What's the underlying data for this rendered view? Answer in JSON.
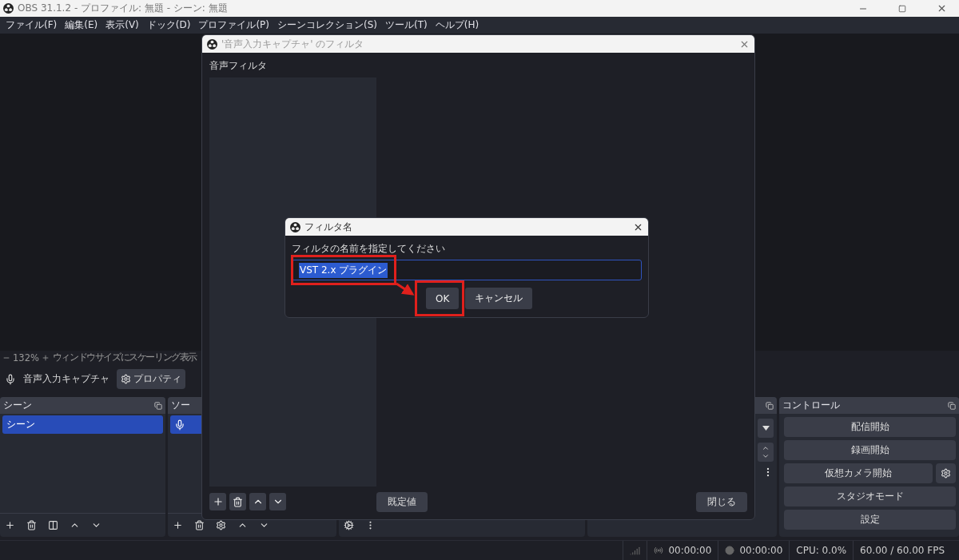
{
  "window": {
    "title": "OBS 31.1.2 - プロファイル: 無題 - シーン: 無題"
  },
  "menu": [
    {
      "label": "ファイル(F)"
    },
    {
      "label": "編集(E)"
    },
    {
      "label": "表示(V)"
    },
    {
      "label": "ドック(D)"
    },
    {
      "label": "プロファイル(P)"
    },
    {
      "label": "シーンコレクション(S)"
    },
    {
      "label": "ツール(T)"
    },
    {
      "label": "ヘルプ(H)"
    }
  ],
  "preview_bar": {
    "zoom": "132%",
    "scale_mode": "ウィンドウサイズにスケーリング表示"
  },
  "source_toolbar": {
    "source": "音声入力キャプチャ",
    "properties": "プロパティ"
  },
  "scenes": {
    "title": "シーン",
    "items": [
      {
        "label": "シーン",
        "selected": true
      }
    ]
  },
  "sources": {
    "title": "ソー",
    "items": [
      {
        "kind": "audio_input",
        "selected": true
      }
    ]
  },
  "controls": {
    "title": "コントロール",
    "buttons": [
      {
        "label": "配信開始",
        "kind": "plain"
      },
      {
        "label": "録画開始",
        "kind": "plain"
      },
      {
        "label": "仮想カメラ開始",
        "kind": "with_settings"
      },
      {
        "label": "スタジオモード",
        "kind": "plain"
      },
      {
        "label": "設定",
        "kind": "plain"
      }
    ]
  },
  "status_bar": {
    "stream_time": "00:00:00",
    "record_time": "00:00:00",
    "cpu": "CPU: 0.0%",
    "fps": "60.00 / 60.00 FPS"
  },
  "filter_dialog": {
    "title": "'音声入力キャプチャ' のフィルタ",
    "section": "音声フィルタ",
    "defaults_button": "既定値",
    "close_button": "閉じる"
  },
  "name_dialog": {
    "title": "フィルタ名",
    "prompt": "フィルタの名前を指定してください",
    "value": "VST 2.x プラグイン",
    "value_selected": true,
    "buttons": [
      {
        "label": "OK",
        "highlighted": true
      },
      {
        "label": "キャンセル",
        "highlighted": false
      }
    ]
  }
}
